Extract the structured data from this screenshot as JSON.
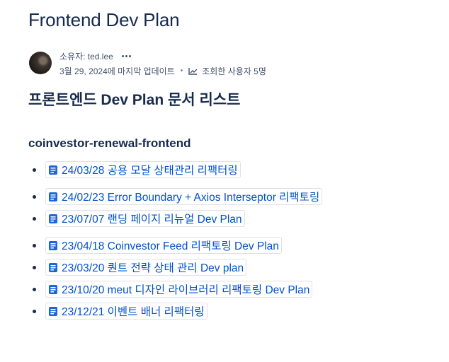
{
  "page": {
    "title": "Frontend Dev Plan",
    "owner_label": "소유자: ted.lee",
    "updated": "3월 29, 2024에 마지막 업데이트",
    "separator": "•",
    "viewers": "조회한 사용자 5명",
    "heading": "프론트엔드 Dev Plan 문서 리스트",
    "section": "coinvestor-renewal-frontend"
  },
  "icons": {
    "more": "more-dots-icon",
    "analytics": "trend-chart-icon",
    "page": "page-document-icon"
  },
  "colors": {
    "link": "#0052cc",
    "page_icon": "#1868db",
    "text": "#172b4d",
    "meta": "#42526e"
  },
  "documents": [
    {
      "label": "24/03/28 공용 모달 상태관리 리팩터링"
    },
    {
      "label": "24/02/23 Error Boundary + Axios Interseptor 리팩토링"
    },
    {
      "label": "23/07/07 랜딩 페이지 리뉴얼 Dev Plan"
    },
    {
      "label": "23/04/18 Coinvestor Feed 리팩토링 Dev Plan"
    },
    {
      "label": "23/03/20 퀀트 전략 상태 관리 Dev plan"
    },
    {
      "label": "23/10/20 meut 디자인 라이브러리 리팩토링 Dev Plan"
    },
    {
      "label": "23/12/21 이벤트 배너 리팩터링"
    }
  ]
}
